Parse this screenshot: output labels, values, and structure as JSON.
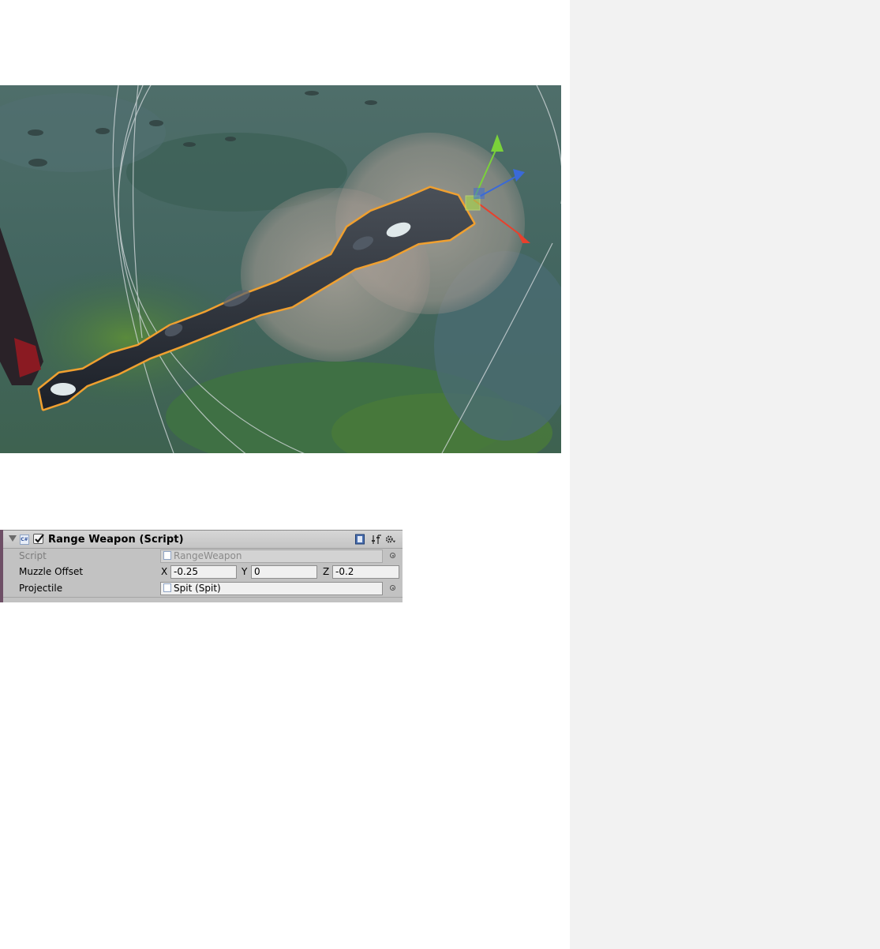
{
  "inspector": {
    "component_title": "Range Weapon (Script)",
    "enabled": true,
    "script_label": "Script",
    "script_value": "RangeWeapon",
    "muzzle_label": "Muzzle Offset",
    "muzzle_offset": {
      "x_label": "X",
      "x": "-0.25",
      "y_label": "Y",
      "y": "0",
      "z_label": "Z",
      "z": "-0.2"
    },
    "projectile_label": "Projectile",
    "projectile_value": "Spit (Spit)",
    "icons": [
      "cs-script-icon",
      "help-book-icon",
      "preset-sliders-icon",
      "gear-icon"
    ]
  },
  "colors": {
    "selection_outline": "#f0a030",
    "gizmo_x": "#e8402c",
    "gizmo_y": "#7ad23a",
    "gizmo_z": "#3a6ad8",
    "right_panel": "#f2f2f2",
    "inspector_bg": "#c2c2c2"
  }
}
